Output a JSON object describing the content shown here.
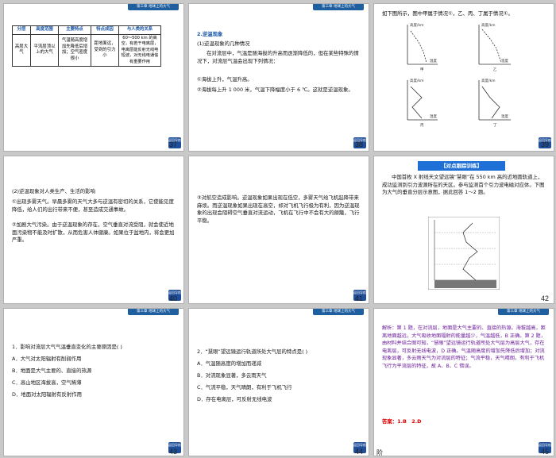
{
  "header": "第三章 地球上的大气",
  "button_label": "返回导航",
  "slide_numbers": [
    "37",
    "38",
    "39",
    "40",
    "41",
    "42",
    "43",
    "44",
    "45"
  ],
  "s37": {
    "headers": [
      "分层",
      "高度范围",
      "主要特点",
      "特点成因",
      "与人类的关系"
    ],
    "row": [
      "高层大气",
      "平流层顶以上的大气",
      "气温随高度增加先降低后增加；空气密度很小",
      "距地面远，受到的引力小",
      "60～500 km 的高空，有若干电离层，电离层能反射无线电短波，对无线电通信有重要作用"
    ]
  },
  "s38": {
    "title": "2.逆温现象",
    "l1": "(1)逆温现象的几种情况",
    "l2": "在对流层中，气温是随海拔的升高而逐渐降低的，但在某些特殊的情况下，对流层气温会出现下列情况：",
    "l3": "①海拔上升，气温升高。",
    "l4": "②海拔每上升 1 000 米，气温下降幅度小于 6 ℃。这就是逆温现象。"
  },
  "s39": {
    "intro": "如下图所示，图中甲属于情况①，乙、丙、丁属于情况①。",
    "ylabel": "高度/km",
    "xlabel": "温度",
    "names": [
      "甲",
      "乙",
      "丙",
      "丁"
    ]
  },
  "s40": {
    "l1": "(2)逆温现象对人类生产、生活的影响",
    "l2": "①出现多雾天气。早晨多雾的天气大多与逆温有密切的关系，它使能见度降低，给人们的出行带来不便，甚至造成交通事故。",
    "l3": "②加剧大气污染。由于逆温现象的存在，空气垂直对流受阻，就会使近地面污染物不能及时扩散，从而危害人体健康。如果位于盆地内，将会更加严重。"
  },
  "s41": {
    "l1": "③对航空造成影响。逆温现象如果出现在低空，多雾天气给飞机起降带来麻烦。而逆温现象如果出现在高空，却对飞机飞行极为有利，因为逆温现象的出现会阻碍空气垂直对流运动，飞机在飞行中不会有大的颠簸，飞行平稳。"
  },
  "s42": {
    "title": "【对点跟踪训练】",
    "text": "中国首枚 X 射线天文望远镜“慧眼”在 550 km 高的近地圆轨道上，成功监测到引力波源所在的天区。参与监测首个引力波电磁对应体。下图为大气的垂直分层示意图，据此回答 1～2 题。"
  },
  "s43": {
    "q": "1．影响对流层大气气温垂直变化的主要原因是(    )",
    "options": [
      "A．大气对太阳辐射有削弱作用",
      "B．地面是大气主要的、直接的热源",
      "C．高山地区海拔高，空气稀薄",
      "D．地面对太阳辐射有反射作用"
    ]
  },
  "s44": {
    "q": "2．“慧眼”望远镜运行轨道所处大气层的特点是(    )",
    "options": [
      "A．气温随高度的增加而递减",
      "B．对流现象显著，多云雨天气",
      "C．气流平稳，天气晴朗，有利于飞机飞行",
      "D．存在电离层，可反射无线电波"
    ]
  },
  "s45": {
    "text": "解析：第 1 题，在对流层，地面是大气主要的、直接的热源。海拔越高，距离地面越远，大气吸收地面辐射的能量越少，气温越低，B 正确。第 2 题，由材料并结合图可知，“慧眼”望远镜运行轨道所处大气层为高层大气，存在电离层，可反射无线电波，D 正确。气温随高度的增加先降低后增加；对流现象显著，多云雨天气为对流层的特征；气流平稳，天气晴朗，有利于飞机飞行为平流层的特征，故 A、B、C 错误。",
    "answer": "答案：1.B　2.D"
  },
  "footer_label": "阶"
}
